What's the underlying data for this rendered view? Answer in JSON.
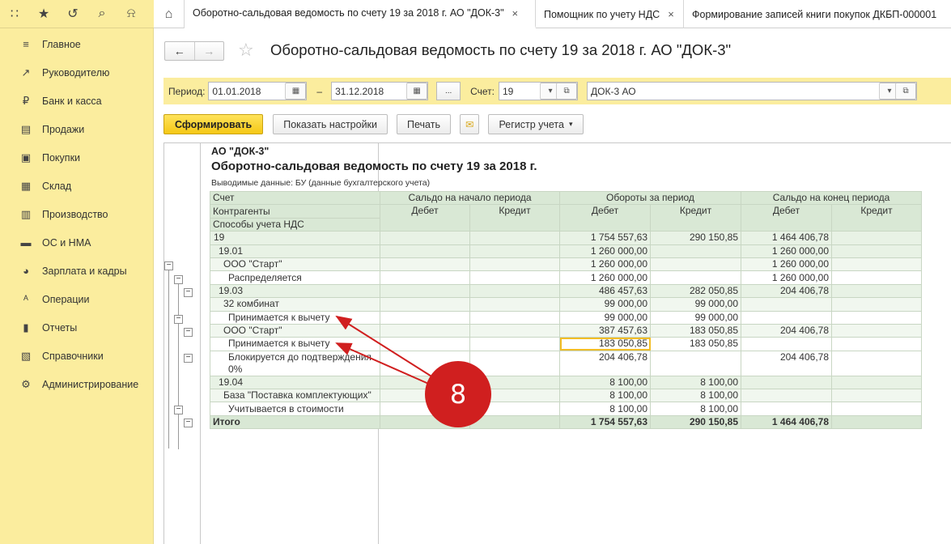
{
  "tabs": [
    {
      "label": "Оборотно-сальдовая ведомость по счету 19 за 2018 г. АО \"ДОК-3\"",
      "close": "×"
    },
    {
      "label": "Помощник по учету НДС",
      "close": "×"
    },
    {
      "label": "Формирование записей книги покупок ДКБП-000001"
    }
  ],
  "top_icons": [
    "apps-grid-icon",
    "star-icon",
    "history-icon",
    "search-icon",
    "bell-icon"
  ],
  "sidebar": {
    "items": [
      {
        "label": "Главное",
        "icon": "≡"
      },
      {
        "label": "Руководителю",
        "icon": "↗"
      },
      {
        "label": "Банк и касса",
        "icon": "₽"
      },
      {
        "label": "Продажи",
        "icon": "▤"
      },
      {
        "label": "Покупки",
        "icon": "▣"
      },
      {
        "label": "Склад",
        "icon": "▦"
      },
      {
        "label": "Производство",
        "icon": "▥"
      },
      {
        "label": "ОС и НМА",
        "icon": "▬"
      },
      {
        "label": "Зарплата и кадры",
        "icon": "◕"
      },
      {
        "label": "Операции",
        "icon": "ᴬ"
      },
      {
        "label": "Отчеты",
        "icon": "▮"
      },
      {
        "label": "Справочники",
        "icon": "▧"
      },
      {
        "label": "Администрирование",
        "icon": "⚙"
      }
    ]
  },
  "header": {
    "title": "Оборотно-сальдовая ведомость по счету 19 за 2018 г. АО \"ДОК-3\""
  },
  "filter": {
    "period_label": "Период:",
    "date_from": "01.01.2018",
    "dash": "–",
    "date_to": "31.12.2018",
    "more": "...",
    "account_label": "Счет:",
    "account": "19",
    "org": "ДОК-3 АО"
  },
  "toolbar": {
    "generate": "Сформировать",
    "settings": "Показать настройки",
    "print": "Печать",
    "register": "Регистр учета"
  },
  "report": {
    "org": "АО \"ДОК-3\"",
    "title": "Оборотно-сальдовая ведомость по счету 19 за 2018 г.",
    "subtitle": "Выводимые данные:  БУ (данные бухгалтерского учета)",
    "headers": {
      "account": "Счет",
      "counterparties": "Контрагенты",
      "vat_methods": "Способы учета НДС",
      "opening": "Сальдо на начало периода",
      "turnover": "Обороты за период",
      "closing": "Сальдо на конец периода",
      "debit": "Дебет",
      "credit": "Кредит"
    },
    "rows": [
      {
        "label": "19",
        "level": 0,
        "od": "",
        "oc": "",
        "td": "1 754 557,63",
        "tc": "290 150,85",
        "cd": "1 464 406,78",
        "cc": ""
      },
      {
        "label": "19.01",
        "level": 1,
        "od": "",
        "oc": "",
        "td": "1 260 000,00",
        "tc": "",
        "cd": "1 260 000,00",
        "cc": ""
      },
      {
        "label": "ООО \"Старт\"",
        "level": 2,
        "od": "",
        "oc": "",
        "td": "1 260 000,00",
        "tc": "",
        "cd": "1 260 000,00",
        "cc": ""
      },
      {
        "label": "Распределяется",
        "level": 3,
        "od": "",
        "oc": "",
        "td": "1 260 000,00",
        "tc": "",
        "cd": "1 260 000,00",
        "cc": ""
      },
      {
        "label": "19.03",
        "level": 1,
        "od": "",
        "oc": "",
        "td": "486 457,63",
        "tc": "282 050,85",
        "cd": "204 406,78",
        "cc": ""
      },
      {
        "label": "32 комбинат",
        "level": 2,
        "od": "",
        "oc": "",
        "td": "99 000,00",
        "tc": "99 000,00",
        "cd": "",
        "cc": ""
      },
      {
        "label": "Принимается к вычету",
        "level": 3,
        "od": "",
        "oc": "",
        "td": "99 000,00",
        "tc": "99 000,00",
        "cd": "",
        "cc": ""
      },
      {
        "label": "ООО \"Старт\"",
        "level": 2,
        "od": "",
        "oc": "",
        "td": "387 457,63",
        "tc": "183 050,85",
        "cd": "204 406,78",
        "cc": ""
      },
      {
        "label": "Принимается к вычету",
        "level": 3,
        "od": "",
        "oc": "",
        "td": "183 050,85",
        "tc": "183 050,85",
        "cd": "",
        "cc": "",
        "selected": true
      },
      {
        "label": "Блокируется до подтверждения",
        "label2": "0%",
        "level": 3,
        "od": "",
        "oc": "",
        "td": "204 406,78",
        "tc": "",
        "cd": "204 406,78",
        "cc": ""
      },
      {
        "label": "19.04",
        "level": 1,
        "od": "",
        "oc": "",
        "td": "8 100,00",
        "tc": "8 100,00",
        "cd": "",
        "cc": ""
      },
      {
        "label": "База \"Поставка комплектующих\"",
        "level": 2,
        "od": "",
        "oc": "",
        "td": "8 100,00",
        "tc": "8 100,00",
        "cd": "",
        "cc": ""
      },
      {
        "label": "Учитывается в стоимости",
        "level": 3,
        "od": "",
        "oc": "",
        "td": "8 100,00",
        "tc": "8 100,00",
        "cd": "",
        "cc": ""
      }
    ],
    "total": {
      "label": "Итого",
      "td": "1 754 557,63",
      "tc": "290 150,85",
      "cd": "1 464 406,78"
    }
  },
  "annotation": {
    "number": "8",
    "color": "#d01f1f"
  }
}
